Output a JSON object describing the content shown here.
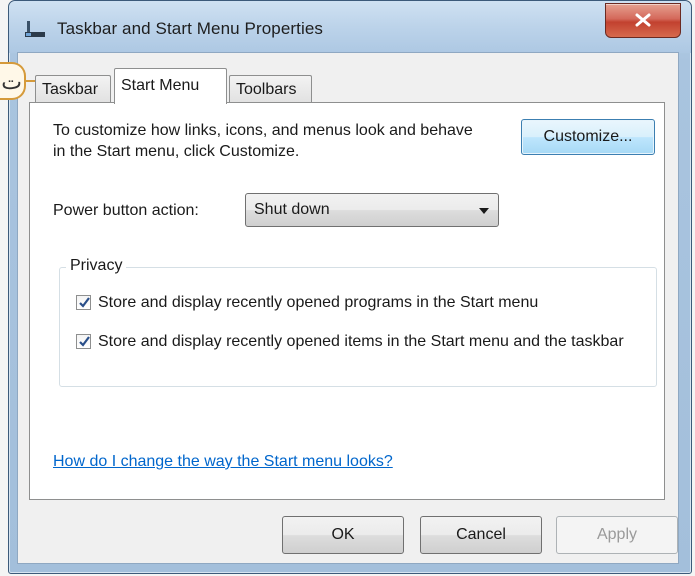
{
  "window": {
    "title": "Taskbar and Start Menu Properties"
  },
  "callout": {
    "text": "ت"
  },
  "tabs": [
    {
      "label": "Taskbar"
    },
    {
      "label": "Start Menu"
    },
    {
      "label": "Toolbars"
    }
  ],
  "start_menu": {
    "description": "To customize how links, icons, and menus look and behave in the Start menu, click Customize.",
    "customize_label": "Customize...",
    "power_label": "Power button action:",
    "power_value": "Shut down",
    "privacy_legend": "Privacy",
    "checkboxes": [
      {
        "label": "Store and display recently opened programs in the Start menu",
        "checked": true
      },
      {
        "label": "Store and display recently opened items in the Start menu and the taskbar",
        "checked": true
      }
    ],
    "help_link": "How do I change the way the Start menu looks?"
  },
  "buttons": {
    "ok": "OK",
    "cancel": "Cancel",
    "apply": "Apply"
  },
  "icons": {
    "app": "taskbar-icon",
    "close": "close-icon",
    "dropdown": "chevron-down-icon",
    "check": "checkmark-icon"
  },
  "colors": {
    "link": "#0066cc",
    "close_button": "#c2412f",
    "title_bar": "#bcd3ea"
  }
}
